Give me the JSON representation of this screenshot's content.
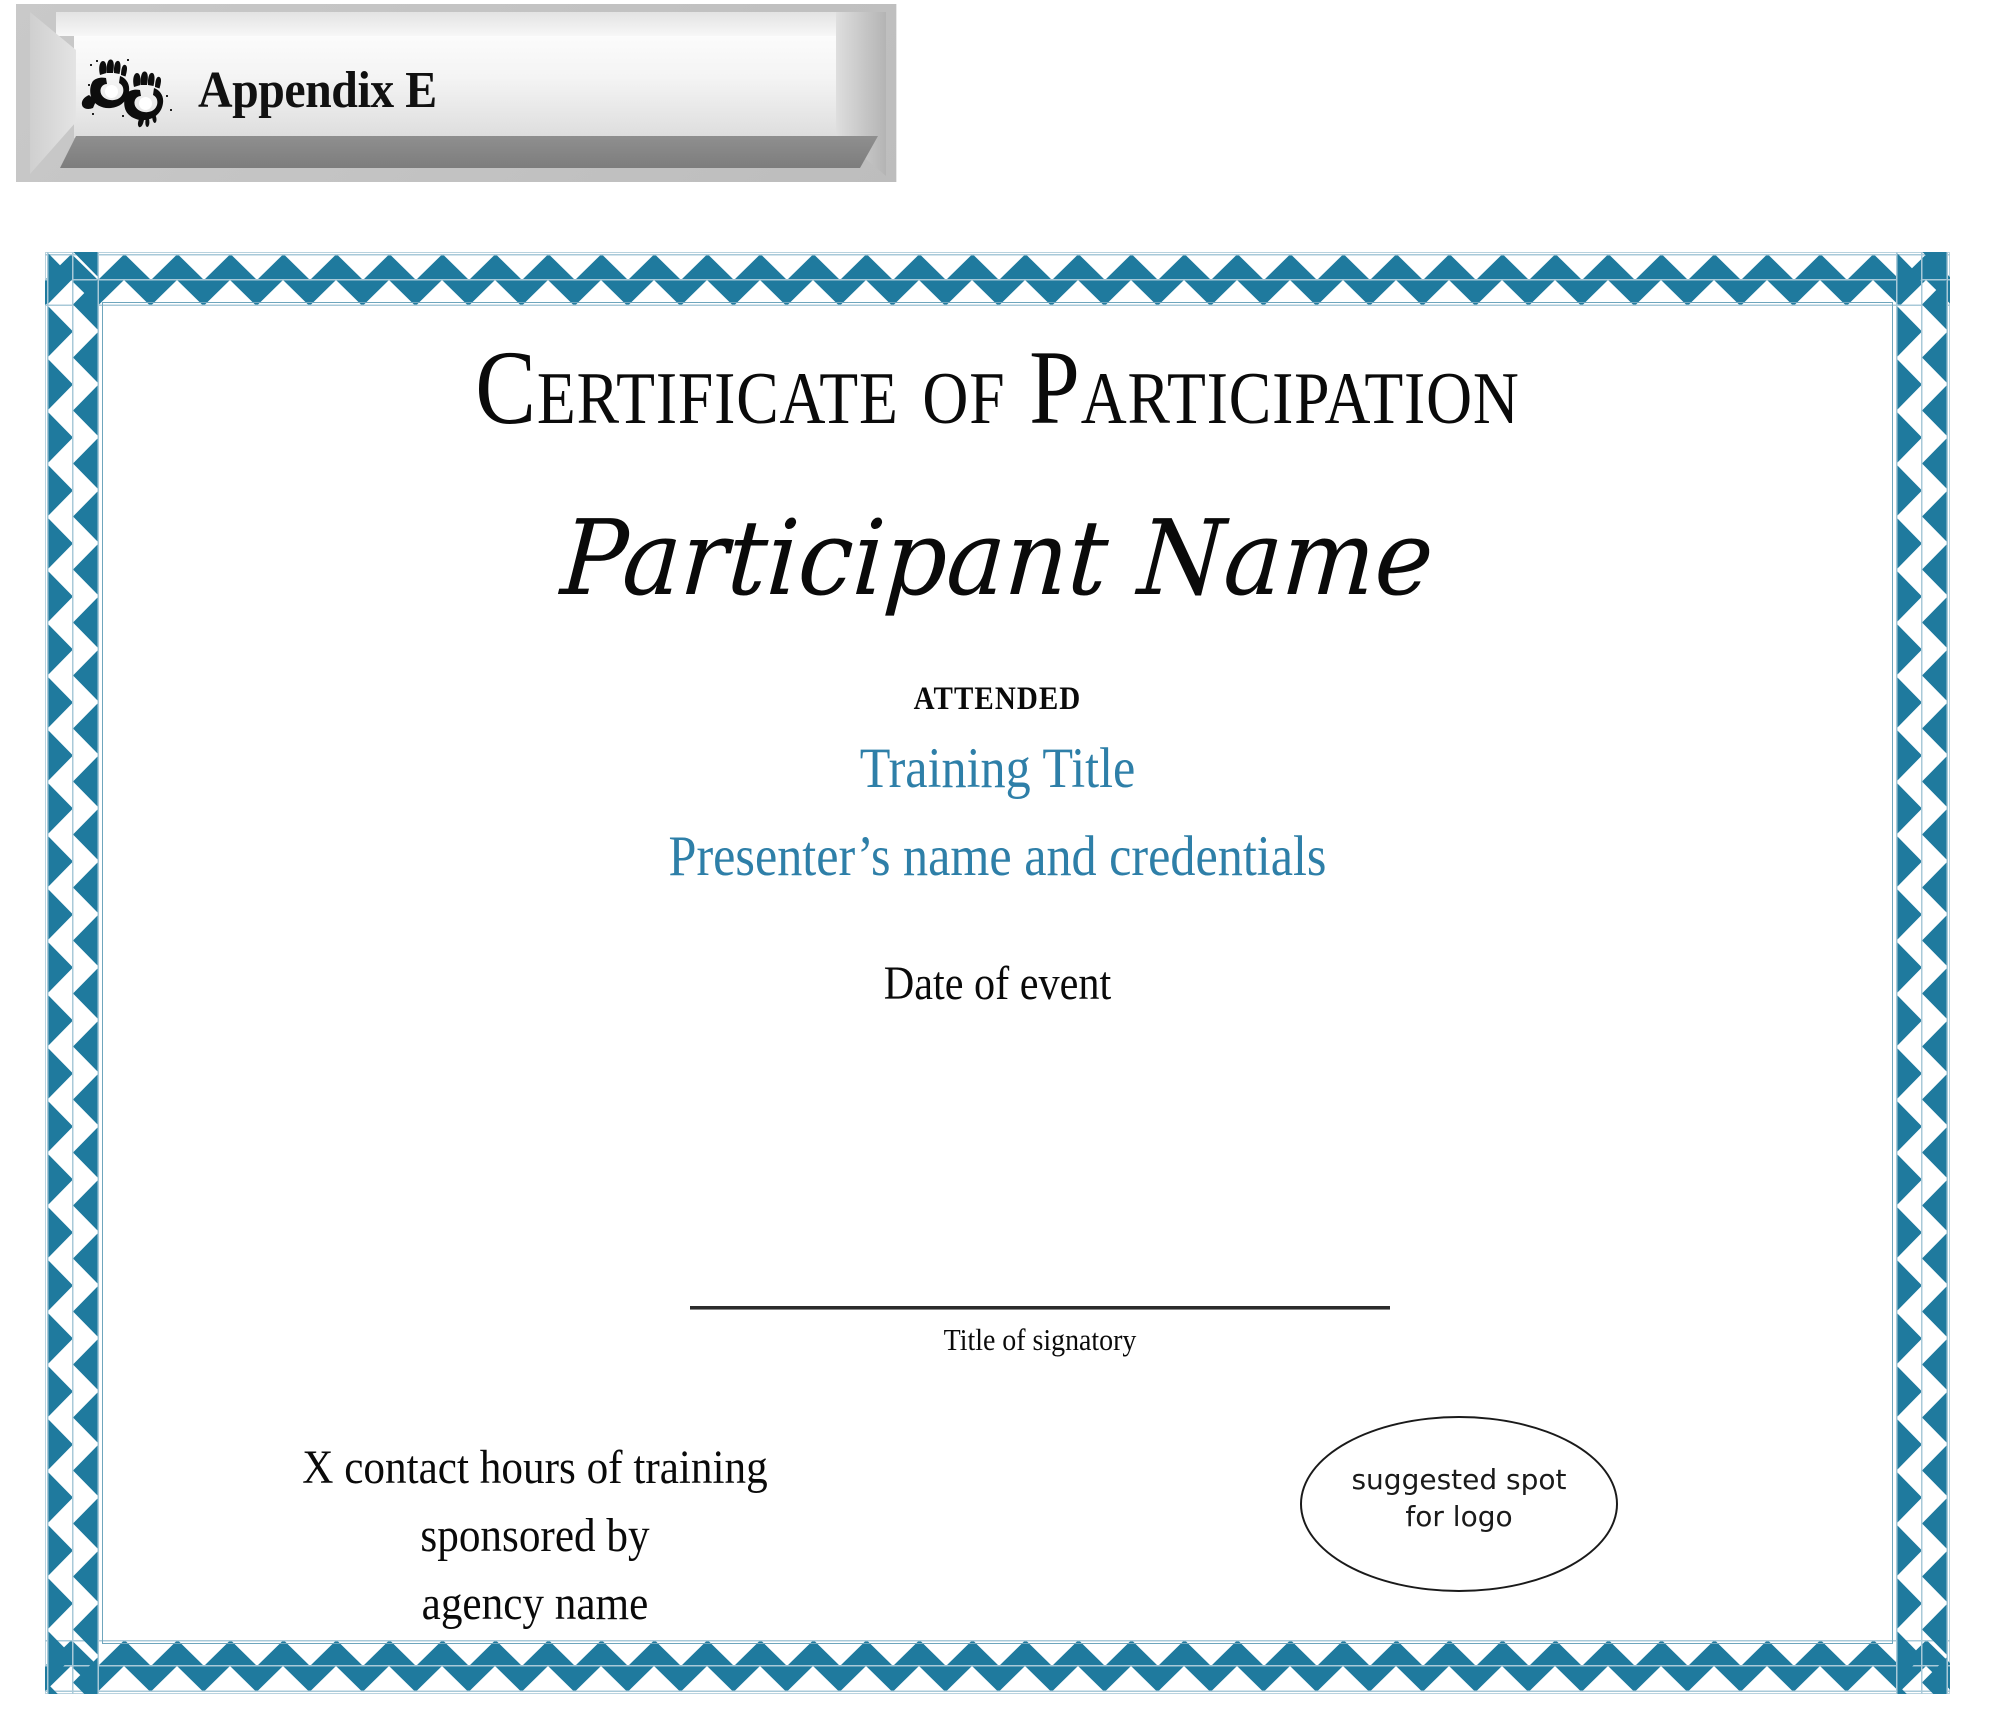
{
  "appendix_tab": {
    "label": "Appendix E",
    "icon": "sign-language-hands-icon"
  },
  "certificate": {
    "title": "Certificate of Participation",
    "participant_name": "Participant Name",
    "attended_label": "ATTENDED",
    "training_title": "Training Title",
    "presenter": "Presenter’s name and credentials",
    "date_of_event": "Date of event",
    "signatory_label": "Title of signatory",
    "sponsor_lines": [
      "X contact hours of training",
      "sponsored by",
      "agency name"
    ],
    "logo_spot": {
      "line1": "suggested spot",
      "line2": "for logo"
    },
    "colors": {
      "border_teal": "#1f7a9e",
      "accent_text_blue": "#2e7fa8",
      "hairline": "#a8c9d8",
      "body_text": "#0a0a0a"
    }
  }
}
